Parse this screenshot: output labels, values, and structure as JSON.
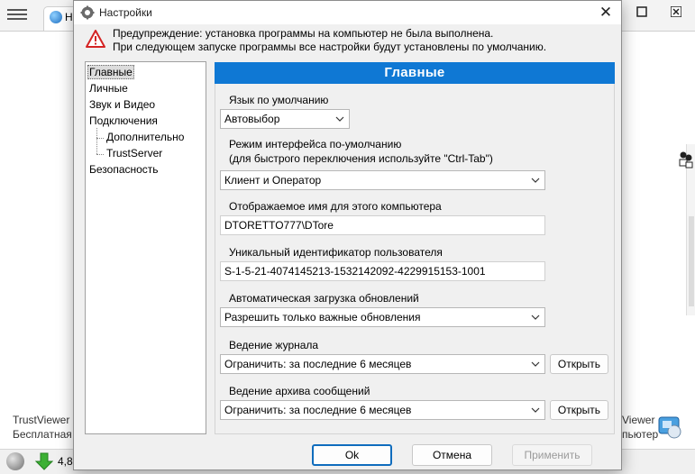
{
  "background_app": {
    "tab_label_partial": "Н",
    "left_text": [
      "TrustViewer",
      "Бесплатная"
    ],
    "right_text": [
      "Viewer",
      "пьютер"
    ],
    "status_number": "4,8"
  },
  "dialog": {
    "title": "Настройки",
    "close_glyph": "✕",
    "warning": {
      "line1": "Предупреждение: установка программы на компьютер не была выполнена.",
      "line2": "При следующем запуске программы все настройки будут установлены по умолчанию."
    },
    "tree": {
      "items": [
        {
          "label": "Главные",
          "selected": true
        },
        {
          "label": "Личные"
        },
        {
          "label": "Звук и Видео"
        },
        {
          "label": "Подключения"
        },
        {
          "label": "Дополнительно"
        },
        {
          "label": "TrustServer"
        },
        {
          "label": "Безопасность"
        }
      ]
    },
    "panel": {
      "header": "Главные",
      "language": {
        "label": "Язык по умолчанию",
        "value": "Автовыбор"
      },
      "ui_mode": {
        "label_line1": "Режим интерфейса по-умолчанию",
        "label_line2": "(для быстрого переключения используйте \"Ctrl-Tab\")",
        "value": "Клиент и Оператор"
      },
      "display_name": {
        "label": "Отображаемое имя для этого компьютера",
        "value": "DTORETTO777\\DTore"
      },
      "user_id": {
        "label": "Уникальный идентификатор пользователя",
        "value": "S-1-5-21-4074145213-1532142092-4229915153-1001"
      },
      "updates": {
        "label": "Автоматическая загрузка обновлений",
        "value": "Разрешить только важные обновления"
      },
      "logging": {
        "label": "Ведение журнала",
        "value": "Ограничить: за последние 6 месяцев",
        "button": "Открыть"
      },
      "archive": {
        "label": "Ведение архива сообщений",
        "value": "Ограничить: за последние 6 месяцев",
        "button": "Открыть"
      }
    },
    "buttons": {
      "ok": "Ok",
      "cancel": "Отмена",
      "apply": "Применить"
    }
  },
  "colors": {
    "header_blue": "#0f78d4",
    "default_button_border": "#0f6cbd",
    "warning_red": "#d42424"
  }
}
